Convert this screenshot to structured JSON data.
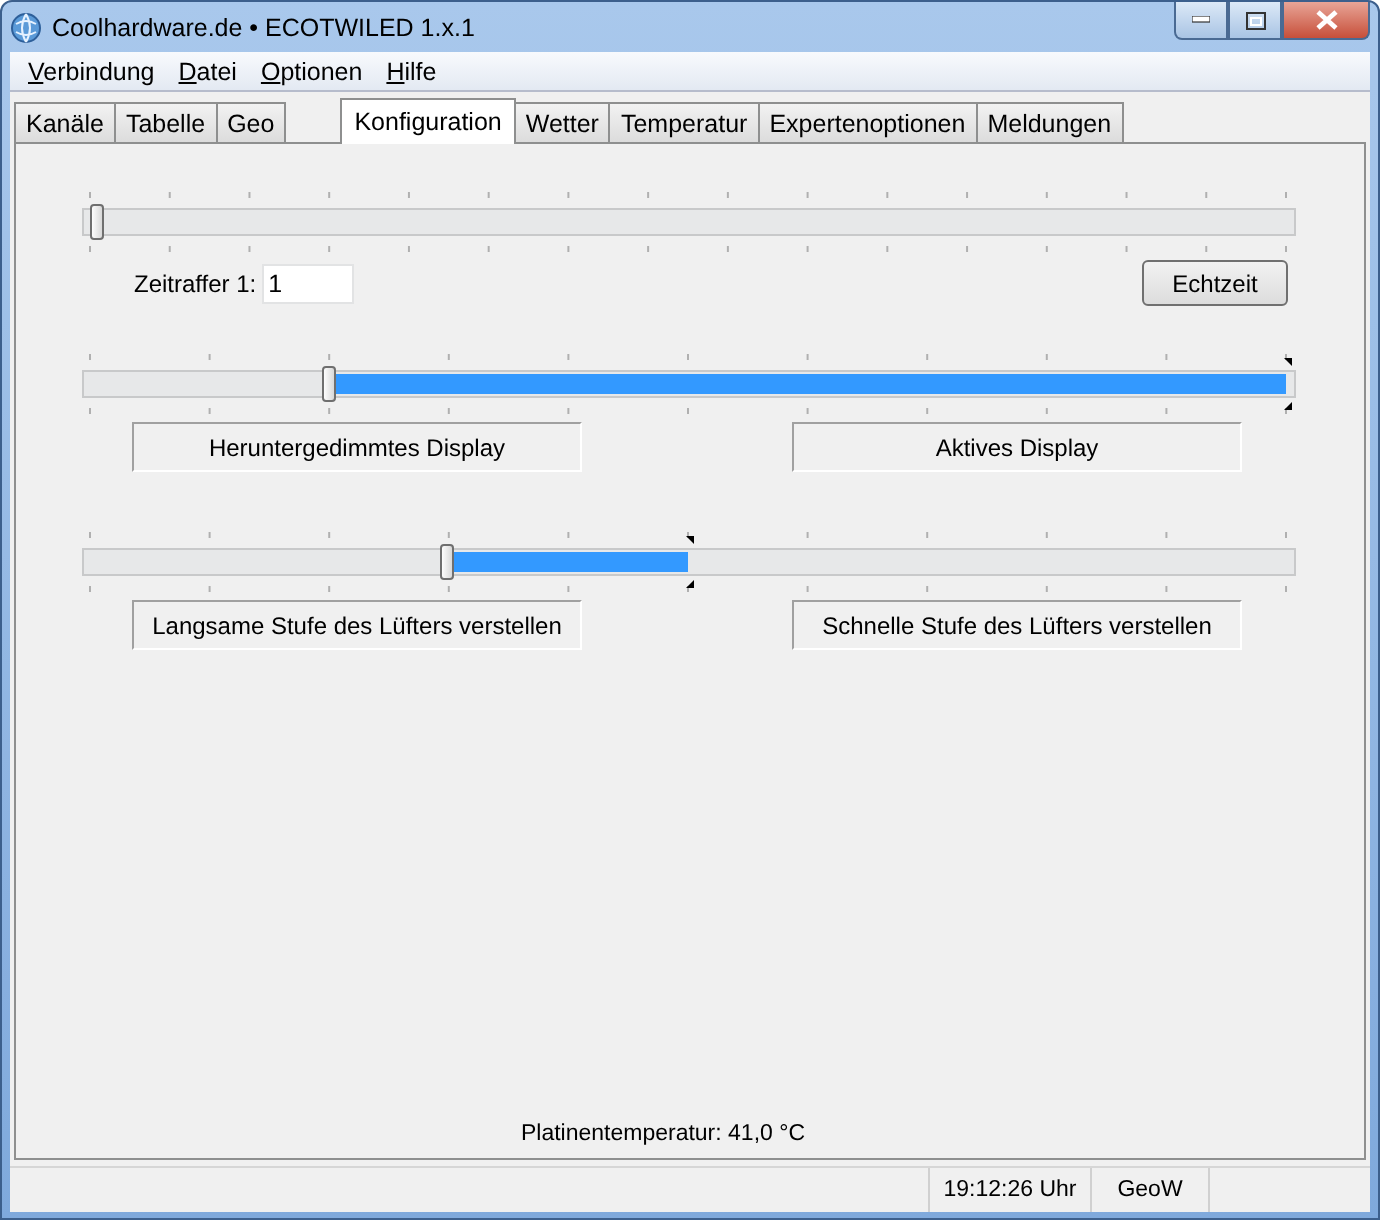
{
  "window": {
    "title": "Coolhardware.de • ECOTWILED 1.x.1"
  },
  "menu": [
    "Verbindung",
    "Datei",
    "Optionen",
    "Hilfe"
  ],
  "tabs": [
    {
      "label": "Kanäle",
      "selected": false
    },
    {
      "label": "Tabelle",
      "selected": false
    },
    {
      "label": "Geo",
      "selected": false
    },
    {
      "label": "Konfiguration",
      "selected": true
    },
    {
      "label": "Wetter",
      "selected": false
    },
    {
      "label": "Temperatur",
      "selected": false
    },
    {
      "label": "Expertenoptionen",
      "selected": false
    },
    {
      "label": "Meldungen",
      "selected": false
    }
  ],
  "timelapse": {
    "slider": {
      "level": 0
    },
    "label": "Zeitraffer 1:",
    "value": "1",
    "button": "Echtzeit"
  },
  "ranges": [
    {
      "low": {
        "level": 0.2
      },
      "high": {
        "level": 1
      },
      "buttons": [
        "Heruntergedimmtes Display",
        "Aktives Display"
      ]
    },
    {
      "low": {
        "level": 0.3
      },
      "high": {
        "level": 0.5
      },
      "buttons": [
        "Langsame Stufe des Lüfters verstellen",
        "Schnelle Stufe des Lüfters verstellen"
      ]
    }
  ],
  "board_temperature": "Platinentemperatur: 41,0 °C",
  "status_bar": [
    "19:12:26 Uhr",
    "GeoW"
  ]
}
